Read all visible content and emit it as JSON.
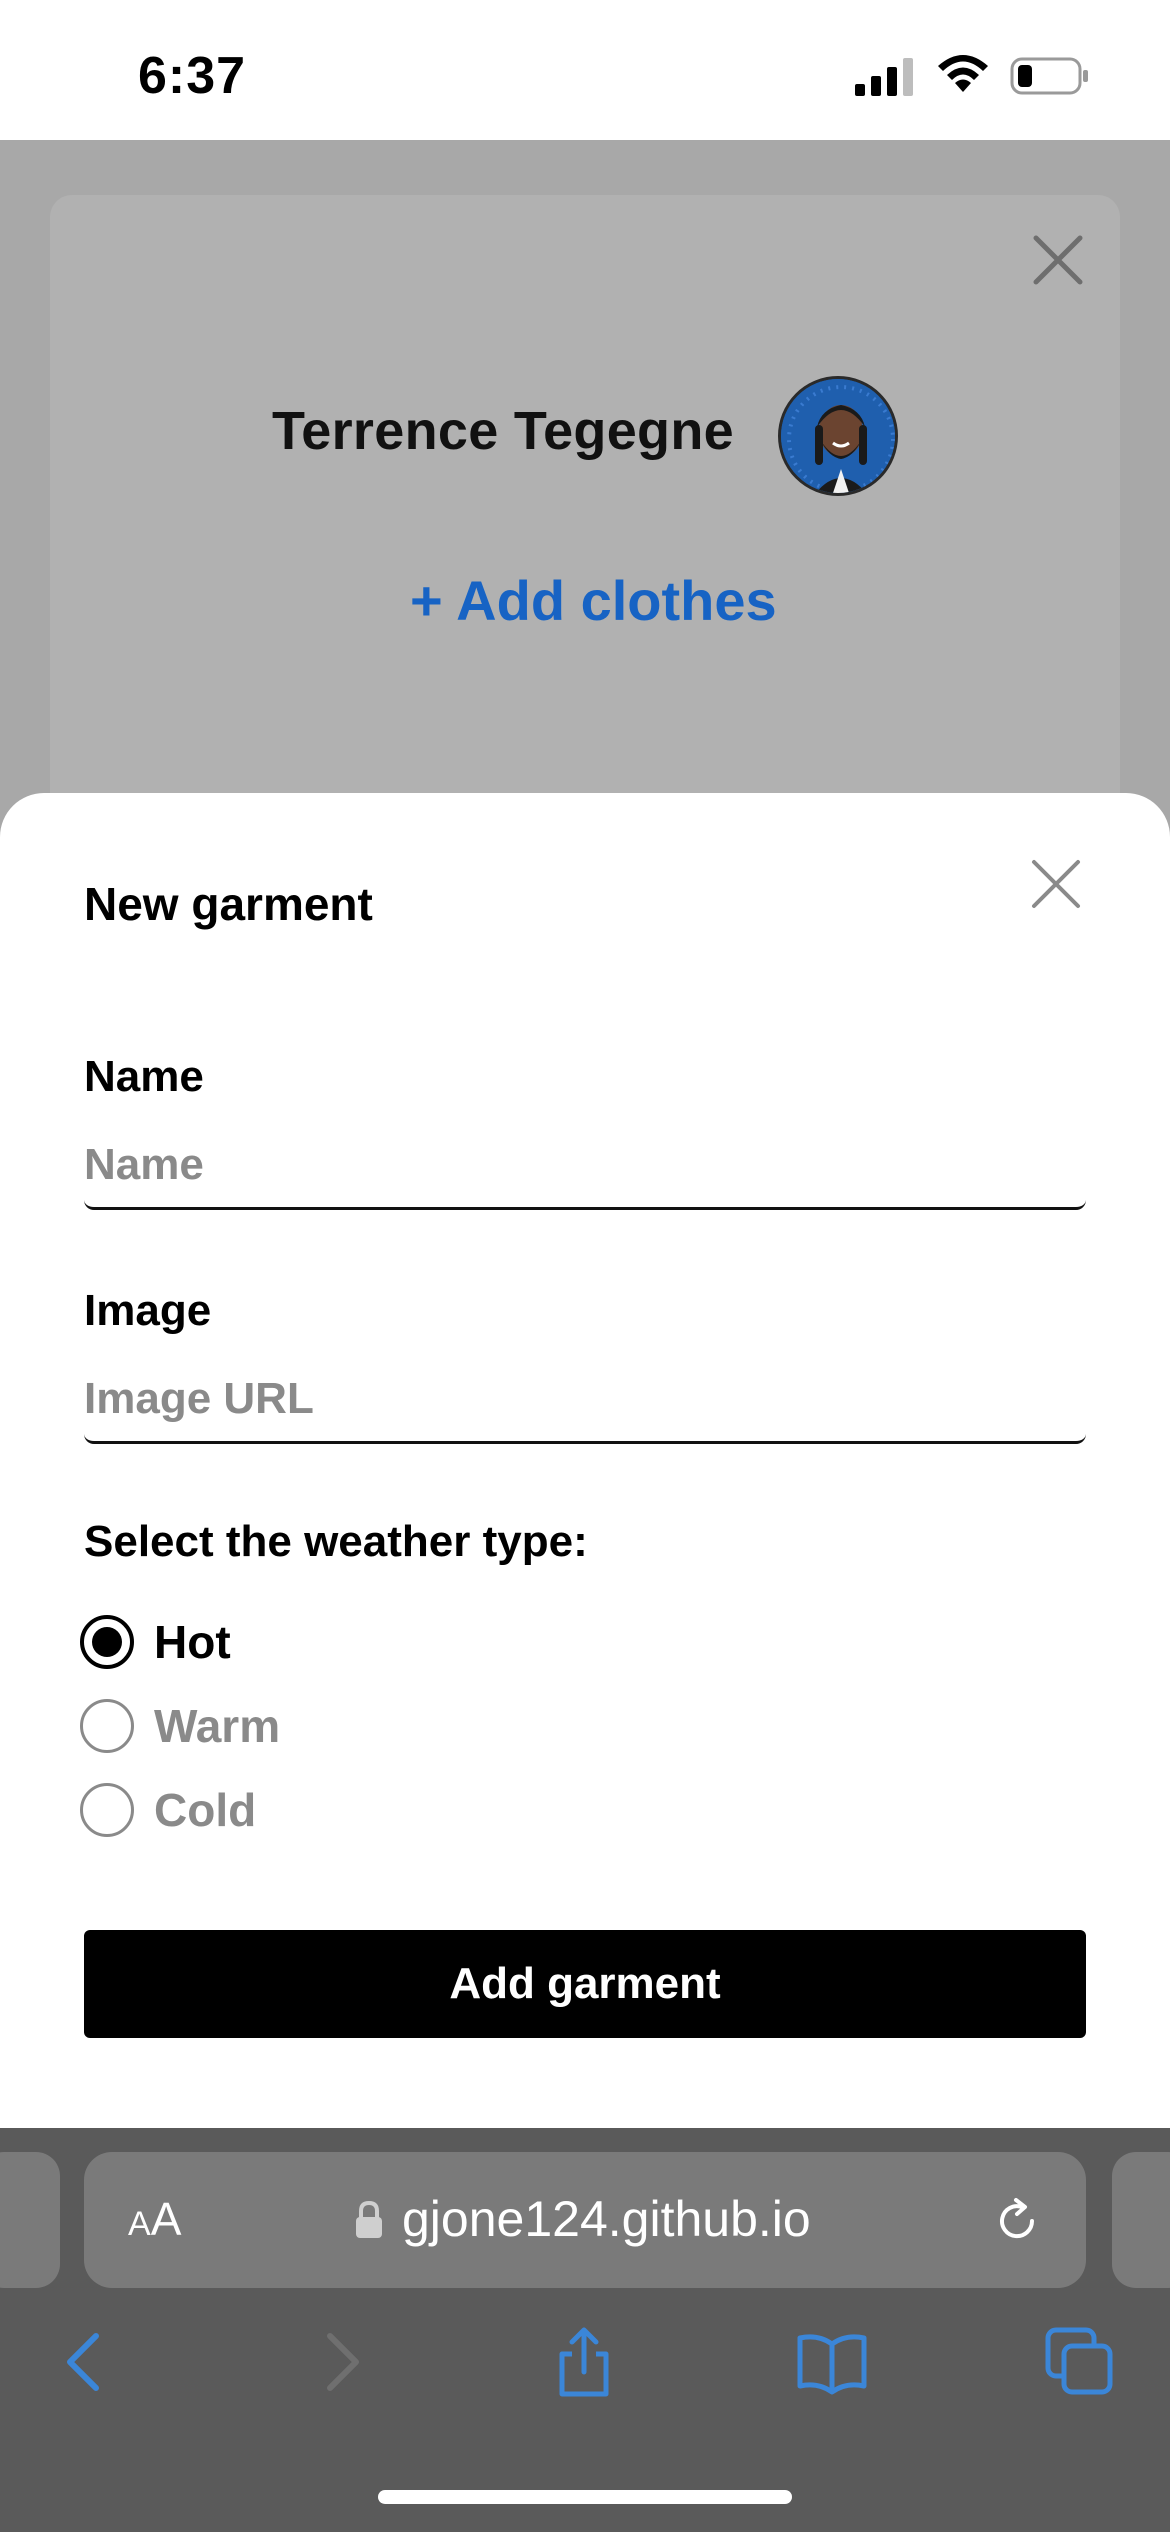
{
  "status_bar": {
    "time": "6:37"
  },
  "profile": {
    "name": "Terrence Tegegne",
    "add_clothes_label": "+ Add clothes"
  },
  "modal": {
    "title": "New garment",
    "name_label": "Name",
    "name_placeholder": "Name",
    "image_label": "Image",
    "image_placeholder": "Image URL",
    "weather_label": "Select the weather type:",
    "weather_options": [
      {
        "label": "Hot",
        "selected": true
      },
      {
        "label": "Warm",
        "selected": false
      },
      {
        "label": "Cold",
        "selected": false
      }
    ],
    "submit_label": "Add garment"
  },
  "browser": {
    "text_size_label_small": "A",
    "text_size_label_large": "A",
    "url": "gjone124.github.io"
  },
  "colors": {
    "accent_blue": "#1763c4",
    "safari_blue": "#3b86d8",
    "dim_overlay": "#a8a8a8",
    "button_black": "#000000"
  },
  "icons": {
    "card_close": "close-icon",
    "modal_close": "close-icon",
    "lock": "lock-icon",
    "reload": "reload-icon",
    "back": "chevron-left-icon",
    "forward": "chevron-right-icon",
    "share": "share-icon",
    "bookmarks": "book-icon",
    "tabs": "tabs-icon"
  }
}
